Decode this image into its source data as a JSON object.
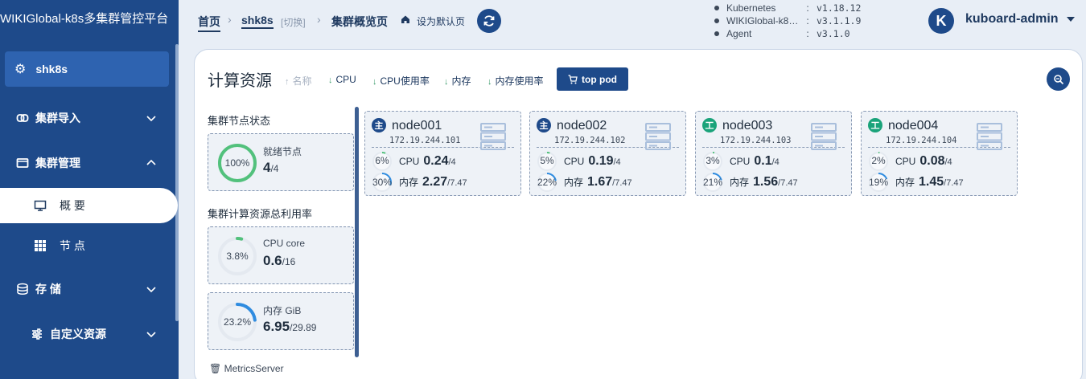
{
  "app": {
    "title": "WIKIGlobal-k8s多集群管控平台"
  },
  "sidebar": {
    "cluster_name": "shk8s",
    "items": [
      {
        "label": "集群导入"
      },
      {
        "label": "集群管理"
      },
      {
        "label": "概 要"
      },
      {
        "label": "节 点"
      },
      {
        "label": "存 储"
      },
      {
        "label": "自定义资源"
      }
    ]
  },
  "breadcrumb": {
    "home": "首页",
    "cluster": "shk8s",
    "switch": "[切换]",
    "current": "集群概览页",
    "set_default": "设为默认页"
  },
  "versions": [
    {
      "name": "Kubernetes",
      "value": "v1.18.12"
    },
    {
      "name": "WIKIGlobal-k8…",
      "value": "v3.1.1.9"
    },
    {
      "name": "Agent",
      "value": "v3.1.0"
    }
  ],
  "user": {
    "avatar_letter": "K",
    "name": "kuboard-admin"
  },
  "main": {
    "title": "计算资源",
    "sort": [
      {
        "label": "名称",
        "muted": true
      },
      {
        "label": "CPU"
      },
      {
        "label": "CPU使用率"
      },
      {
        "label": "内存"
      },
      {
        "label": "内存使用率"
      }
    ],
    "top_pod_label": "top pod"
  },
  "cluster_status": {
    "section_title": "集群节点状态",
    "ready": {
      "percent_label": "100%",
      "percent": 100,
      "label": "就绪节点",
      "value": "4",
      "total": "/4"
    }
  },
  "cluster_usage": {
    "section_title": "集群计算资源总利用率",
    "cpu": {
      "percent_label": "3.8%",
      "percent": 3.8,
      "label": "CPU core",
      "value": "0.6",
      "total": "/16"
    },
    "memory": {
      "percent_label": "23.2%",
      "percent": 23.2,
      "label": "内存 GiB",
      "value": "6.95",
      "total": "/29.89"
    },
    "metrics_link": "MetricsServer"
  },
  "colors": {
    "accent": "#1e4a8a",
    "ok_green": "#52c17c",
    "mem_blue": "#2f8ce0"
  },
  "nodes": [
    {
      "role": "master",
      "badge": "主",
      "name": "node001",
      "ip": "172.19.244.101",
      "cpu_pct": "6%",
      "cpu_pct_val": 6,
      "cpu_label": "CPU",
      "cpu_val": "0.24",
      "cpu_total": "/4",
      "mem_pct": "30%",
      "mem_pct_val": 30,
      "mem_label": "内存",
      "mem_val": "2.27",
      "mem_total": "/7.47"
    },
    {
      "role": "master",
      "badge": "主",
      "name": "node002",
      "ip": "172.19.244.102",
      "cpu_pct": "5%",
      "cpu_pct_val": 5,
      "cpu_label": "CPU",
      "cpu_val": "0.19",
      "cpu_total": "/4",
      "mem_pct": "22%",
      "mem_pct_val": 22,
      "mem_label": "内存",
      "mem_val": "1.67",
      "mem_total": "/7.47"
    },
    {
      "role": "worker",
      "badge": "工",
      "name": "node003",
      "ip": "172.19.244.103",
      "cpu_pct": "3%",
      "cpu_pct_val": 3,
      "cpu_label": "CPU",
      "cpu_val": "0.1",
      "cpu_total": "/4",
      "mem_pct": "21%",
      "mem_pct_val": 21,
      "mem_label": "内存",
      "mem_val": "1.56",
      "mem_total": "/7.47"
    },
    {
      "role": "worker",
      "badge": "工",
      "name": "node004",
      "ip": "172.19.244.104",
      "cpu_pct": "2%",
      "cpu_pct_val": 2,
      "cpu_label": "CPU",
      "cpu_val": "0.08",
      "cpu_total": "/4",
      "mem_pct": "19%",
      "mem_pct_val": 19,
      "mem_label": "内存",
      "mem_val": "1.45",
      "mem_total": "/7.47"
    }
  ]
}
